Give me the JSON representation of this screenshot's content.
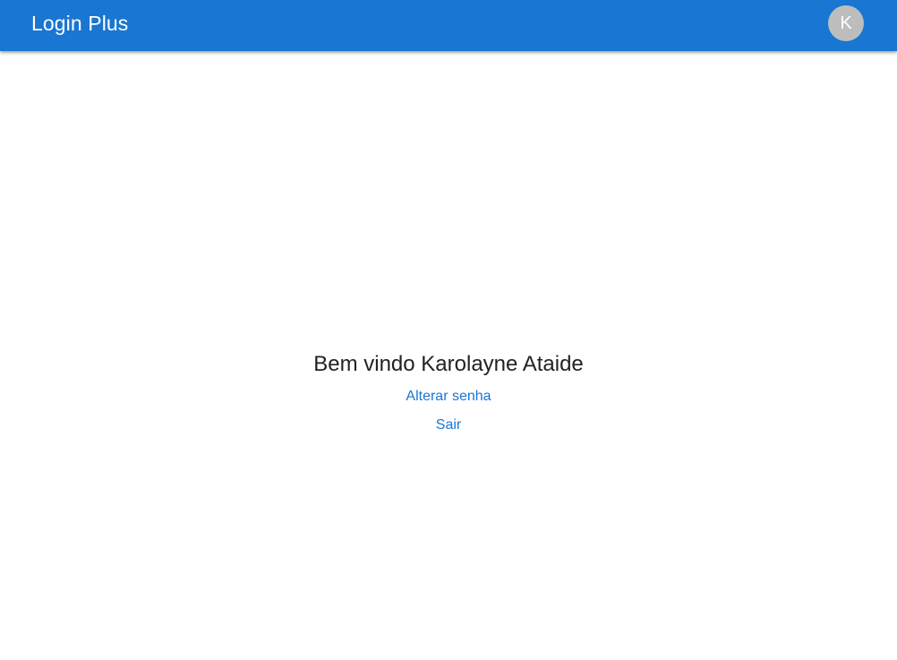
{
  "header": {
    "title": "Login Plus",
    "avatar_initial": "K"
  },
  "main": {
    "welcome": "Bem vindo Karolayne Ataide",
    "change_password_link": "Alterar senha",
    "logout_link": "Sair"
  },
  "colors": {
    "primary": "#1976d2",
    "avatar_bg": "#bdbdbd",
    "text": "#222222",
    "background": "#ffffff"
  }
}
